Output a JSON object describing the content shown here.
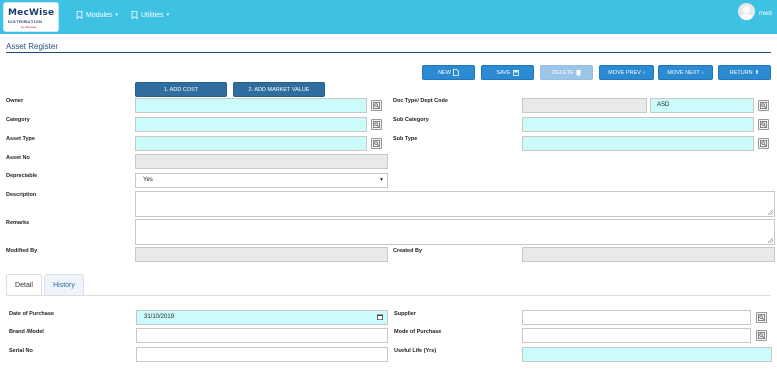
{
  "brand": {
    "name": "MecWise",
    "sub": "DISTRIBUTION",
    "tiny": "by Mecwise"
  },
  "nav": {
    "modules": "Modules",
    "utilities": "Utilities",
    "user": "mwd"
  },
  "page": {
    "title": "Asset Register"
  },
  "toolbar": {
    "new": "NEW",
    "save": "SAVE",
    "delete": "DELETE",
    "move_prev": "MOVE PREV",
    "move_next": "MOVE NEXT",
    "return": "RETURN",
    "add_cost": "1. ADD COST",
    "add_market_value": "2. ADD MARKET VALUE"
  },
  "form": {
    "owner": {
      "label": "Owner",
      "value": ""
    },
    "category": {
      "label": "Category",
      "value": ""
    },
    "asset_type": {
      "label": "Asset Type",
      "value": ""
    },
    "asset_no": {
      "label": "Asset No",
      "value": ""
    },
    "depreciable": {
      "label": "Depreciable",
      "value": "Yes"
    },
    "description": {
      "label": "Description",
      "value": ""
    },
    "remarks": {
      "label": "Remarks",
      "value": ""
    },
    "modified_by": {
      "label": "Modified By",
      "value": ""
    },
    "doc_type": {
      "label": "Doc Type/ Dept Code",
      "doc_value": "",
      "dept_value": "ASD"
    },
    "sub_category": {
      "label": "Sub Category",
      "value": ""
    },
    "sub_type": {
      "label": "Sub Type",
      "value": ""
    },
    "created_by": {
      "label": "Created By",
      "value": ""
    }
  },
  "tabs": [
    {
      "label": "Detail",
      "active": true
    },
    {
      "label": "History",
      "active": false
    }
  ],
  "detail": {
    "date_of_purchase": {
      "label": "Date of Purchase",
      "value": "31/10/2019"
    },
    "brand_model": {
      "label": "Brand /Model",
      "value": ""
    },
    "serial_no": {
      "label": "Serial No",
      "value": ""
    },
    "supplier": {
      "label": "Supplier",
      "value": ""
    },
    "mode_of_purchase": {
      "label": "Mode of Purchase",
      "value": ""
    },
    "useful_life": {
      "label": "Useful Life (Yrs)",
      "value": ""
    }
  },
  "colors": {
    "topbar": "#3ec2e4",
    "button": "#2b8ad2",
    "required_field": "#ccfbfc",
    "readonly_field": "#e9e9e9"
  }
}
